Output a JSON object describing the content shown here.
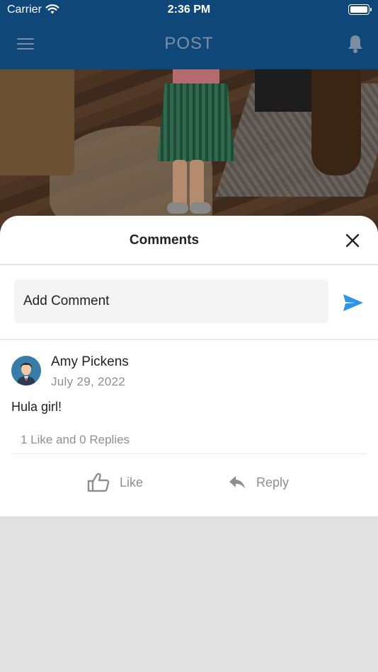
{
  "status_bar": {
    "carrier": "Carrier",
    "time": "2:36 PM"
  },
  "app_bar": {
    "title": "POST"
  },
  "comments_sheet": {
    "title": "Comments",
    "add_comment_placeholder": "Add Comment",
    "comments": [
      {
        "author": "Amy Pickens",
        "date": "July 29, 2022",
        "text": "Hula girl!",
        "stats": "1 Like and 0 Replies",
        "like_label": "Like",
        "reply_label": "Reply"
      }
    ]
  },
  "icons": [
    "menu-icon",
    "bell-icon",
    "close-icon",
    "send-icon",
    "thumbs-up-icon",
    "reply-icon",
    "wifi-icon",
    "battery-icon"
  ],
  "colors": {
    "app_bar": "#0f4779",
    "title": "#7e8fa2",
    "send": "#2f93e8",
    "muted_text": "#8e8e8e",
    "page_bg": "#e1e1e1"
  }
}
